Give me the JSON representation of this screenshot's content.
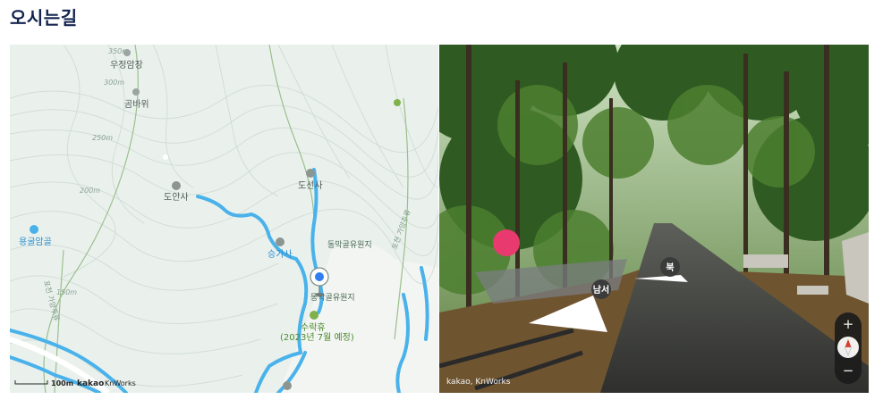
{
  "page": {
    "title": "오시는길"
  },
  "map": {
    "places": [
      {
        "label": "우정암장"
      },
      {
        "label": "곰바위"
      },
      {
        "label": "도안사"
      },
      {
        "label": "도선사"
      },
      {
        "label": "용굴암골"
      },
      {
        "label": "승가사"
      },
      {
        "label": "동막골유원지"
      },
      {
        "label": "동막골유원지"
      },
      {
        "label": "수락휴"
      },
      {
        "label": "(2023년 7월 예정)"
      }
    ],
    "contours": [
      "350m",
      "300m",
      "250m",
      "200m",
      "150m"
    ],
    "trails": [
      "포천 가양주류",
      "포천 가양주류"
    ],
    "scale_label": "100m",
    "brand": "kakao",
    "credit": "KnWorks"
  },
  "roadview": {
    "credit": "kakao, KnWorks",
    "directions": {
      "north": "북",
      "southwest": "남서"
    },
    "zoom_in": "+",
    "zoom_out": "−"
  },
  "colors": {
    "title": "#13244f",
    "route": "#4ab2ea",
    "marker": "#2f7ff0"
  }
}
